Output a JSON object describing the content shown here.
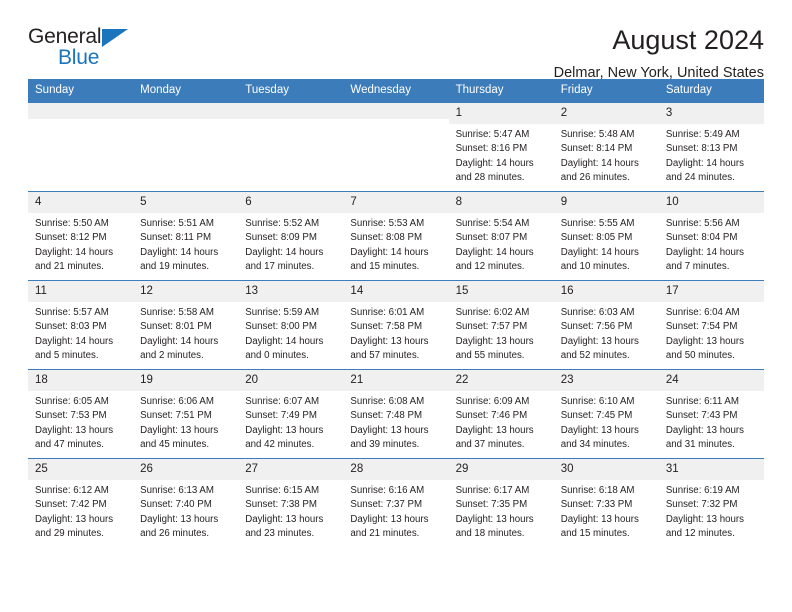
{
  "brand": {
    "name_part1": "General",
    "name_part2": "Blue",
    "accent_color": "#1b75bc"
  },
  "header": {
    "title": "August 2024",
    "location": "Delmar, New York, United States"
  },
  "calendar": {
    "header_bg": "#3d7cba",
    "daynum_bg": "#f0f0f0",
    "weekday_headers": [
      "Sunday",
      "Monday",
      "Tuesday",
      "Wednesday",
      "Thursday",
      "Friday",
      "Saturday"
    ],
    "weeks": [
      [
        {
          "day": "",
          "empty": true
        },
        {
          "day": "",
          "empty": true
        },
        {
          "day": "",
          "empty": true
        },
        {
          "day": "",
          "empty": true
        },
        {
          "day": "1",
          "sunrise": "Sunrise: 5:47 AM",
          "sunset": "Sunset: 8:16 PM",
          "daylight1": "Daylight: 14 hours",
          "daylight2": "and 28 minutes."
        },
        {
          "day": "2",
          "sunrise": "Sunrise: 5:48 AM",
          "sunset": "Sunset: 8:14 PM",
          "daylight1": "Daylight: 14 hours",
          "daylight2": "and 26 minutes."
        },
        {
          "day": "3",
          "sunrise": "Sunrise: 5:49 AM",
          "sunset": "Sunset: 8:13 PM",
          "daylight1": "Daylight: 14 hours",
          "daylight2": "and 24 minutes."
        }
      ],
      [
        {
          "day": "4",
          "sunrise": "Sunrise: 5:50 AM",
          "sunset": "Sunset: 8:12 PM",
          "daylight1": "Daylight: 14 hours",
          "daylight2": "and 21 minutes."
        },
        {
          "day": "5",
          "sunrise": "Sunrise: 5:51 AM",
          "sunset": "Sunset: 8:11 PM",
          "daylight1": "Daylight: 14 hours",
          "daylight2": "and 19 minutes."
        },
        {
          "day": "6",
          "sunrise": "Sunrise: 5:52 AM",
          "sunset": "Sunset: 8:09 PM",
          "daylight1": "Daylight: 14 hours",
          "daylight2": "and 17 minutes."
        },
        {
          "day": "7",
          "sunrise": "Sunrise: 5:53 AM",
          "sunset": "Sunset: 8:08 PM",
          "daylight1": "Daylight: 14 hours",
          "daylight2": "and 15 minutes."
        },
        {
          "day": "8",
          "sunrise": "Sunrise: 5:54 AM",
          "sunset": "Sunset: 8:07 PM",
          "daylight1": "Daylight: 14 hours",
          "daylight2": "and 12 minutes."
        },
        {
          "day": "9",
          "sunrise": "Sunrise: 5:55 AM",
          "sunset": "Sunset: 8:05 PM",
          "daylight1": "Daylight: 14 hours",
          "daylight2": "and 10 minutes."
        },
        {
          "day": "10",
          "sunrise": "Sunrise: 5:56 AM",
          "sunset": "Sunset: 8:04 PM",
          "daylight1": "Daylight: 14 hours",
          "daylight2": "and 7 minutes."
        }
      ],
      [
        {
          "day": "11",
          "sunrise": "Sunrise: 5:57 AM",
          "sunset": "Sunset: 8:03 PM",
          "daylight1": "Daylight: 14 hours",
          "daylight2": "and 5 minutes."
        },
        {
          "day": "12",
          "sunrise": "Sunrise: 5:58 AM",
          "sunset": "Sunset: 8:01 PM",
          "daylight1": "Daylight: 14 hours",
          "daylight2": "and 2 minutes."
        },
        {
          "day": "13",
          "sunrise": "Sunrise: 5:59 AM",
          "sunset": "Sunset: 8:00 PM",
          "daylight1": "Daylight: 14 hours",
          "daylight2": "and 0 minutes."
        },
        {
          "day": "14",
          "sunrise": "Sunrise: 6:01 AM",
          "sunset": "Sunset: 7:58 PM",
          "daylight1": "Daylight: 13 hours",
          "daylight2": "and 57 minutes."
        },
        {
          "day": "15",
          "sunrise": "Sunrise: 6:02 AM",
          "sunset": "Sunset: 7:57 PM",
          "daylight1": "Daylight: 13 hours",
          "daylight2": "and 55 minutes."
        },
        {
          "day": "16",
          "sunrise": "Sunrise: 6:03 AM",
          "sunset": "Sunset: 7:56 PM",
          "daylight1": "Daylight: 13 hours",
          "daylight2": "and 52 minutes."
        },
        {
          "day": "17",
          "sunrise": "Sunrise: 6:04 AM",
          "sunset": "Sunset: 7:54 PM",
          "daylight1": "Daylight: 13 hours",
          "daylight2": "and 50 minutes."
        }
      ],
      [
        {
          "day": "18",
          "sunrise": "Sunrise: 6:05 AM",
          "sunset": "Sunset: 7:53 PM",
          "daylight1": "Daylight: 13 hours",
          "daylight2": "and 47 minutes."
        },
        {
          "day": "19",
          "sunrise": "Sunrise: 6:06 AM",
          "sunset": "Sunset: 7:51 PM",
          "daylight1": "Daylight: 13 hours",
          "daylight2": "and 45 minutes."
        },
        {
          "day": "20",
          "sunrise": "Sunrise: 6:07 AM",
          "sunset": "Sunset: 7:49 PM",
          "daylight1": "Daylight: 13 hours",
          "daylight2": "and 42 minutes."
        },
        {
          "day": "21",
          "sunrise": "Sunrise: 6:08 AM",
          "sunset": "Sunset: 7:48 PM",
          "daylight1": "Daylight: 13 hours",
          "daylight2": "and 39 minutes."
        },
        {
          "day": "22",
          "sunrise": "Sunrise: 6:09 AM",
          "sunset": "Sunset: 7:46 PM",
          "daylight1": "Daylight: 13 hours",
          "daylight2": "and 37 minutes."
        },
        {
          "day": "23",
          "sunrise": "Sunrise: 6:10 AM",
          "sunset": "Sunset: 7:45 PM",
          "daylight1": "Daylight: 13 hours",
          "daylight2": "and 34 minutes."
        },
        {
          "day": "24",
          "sunrise": "Sunrise: 6:11 AM",
          "sunset": "Sunset: 7:43 PM",
          "daylight1": "Daylight: 13 hours",
          "daylight2": "and 31 minutes."
        }
      ],
      [
        {
          "day": "25",
          "sunrise": "Sunrise: 6:12 AM",
          "sunset": "Sunset: 7:42 PM",
          "daylight1": "Daylight: 13 hours",
          "daylight2": "and 29 minutes."
        },
        {
          "day": "26",
          "sunrise": "Sunrise: 6:13 AM",
          "sunset": "Sunset: 7:40 PM",
          "daylight1": "Daylight: 13 hours",
          "daylight2": "and 26 minutes."
        },
        {
          "day": "27",
          "sunrise": "Sunrise: 6:15 AM",
          "sunset": "Sunset: 7:38 PM",
          "daylight1": "Daylight: 13 hours",
          "daylight2": "and 23 minutes."
        },
        {
          "day": "28",
          "sunrise": "Sunrise: 6:16 AM",
          "sunset": "Sunset: 7:37 PM",
          "daylight1": "Daylight: 13 hours",
          "daylight2": "and 21 minutes."
        },
        {
          "day": "29",
          "sunrise": "Sunrise: 6:17 AM",
          "sunset": "Sunset: 7:35 PM",
          "daylight1": "Daylight: 13 hours",
          "daylight2": "and 18 minutes."
        },
        {
          "day": "30",
          "sunrise": "Sunrise: 6:18 AM",
          "sunset": "Sunset: 7:33 PM",
          "daylight1": "Daylight: 13 hours",
          "daylight2": "and 15 minutes."
        },
        {
          "day": "31",
          "sunrise": "Sunrise: 6:19 AM",
          "sunset": "Sunset: 7:32 PM",
          "daylight1": "Daylight: 13 hours",
          "daylight2": "and 12 minutes."
        }
      ]
    ]
  }
}
